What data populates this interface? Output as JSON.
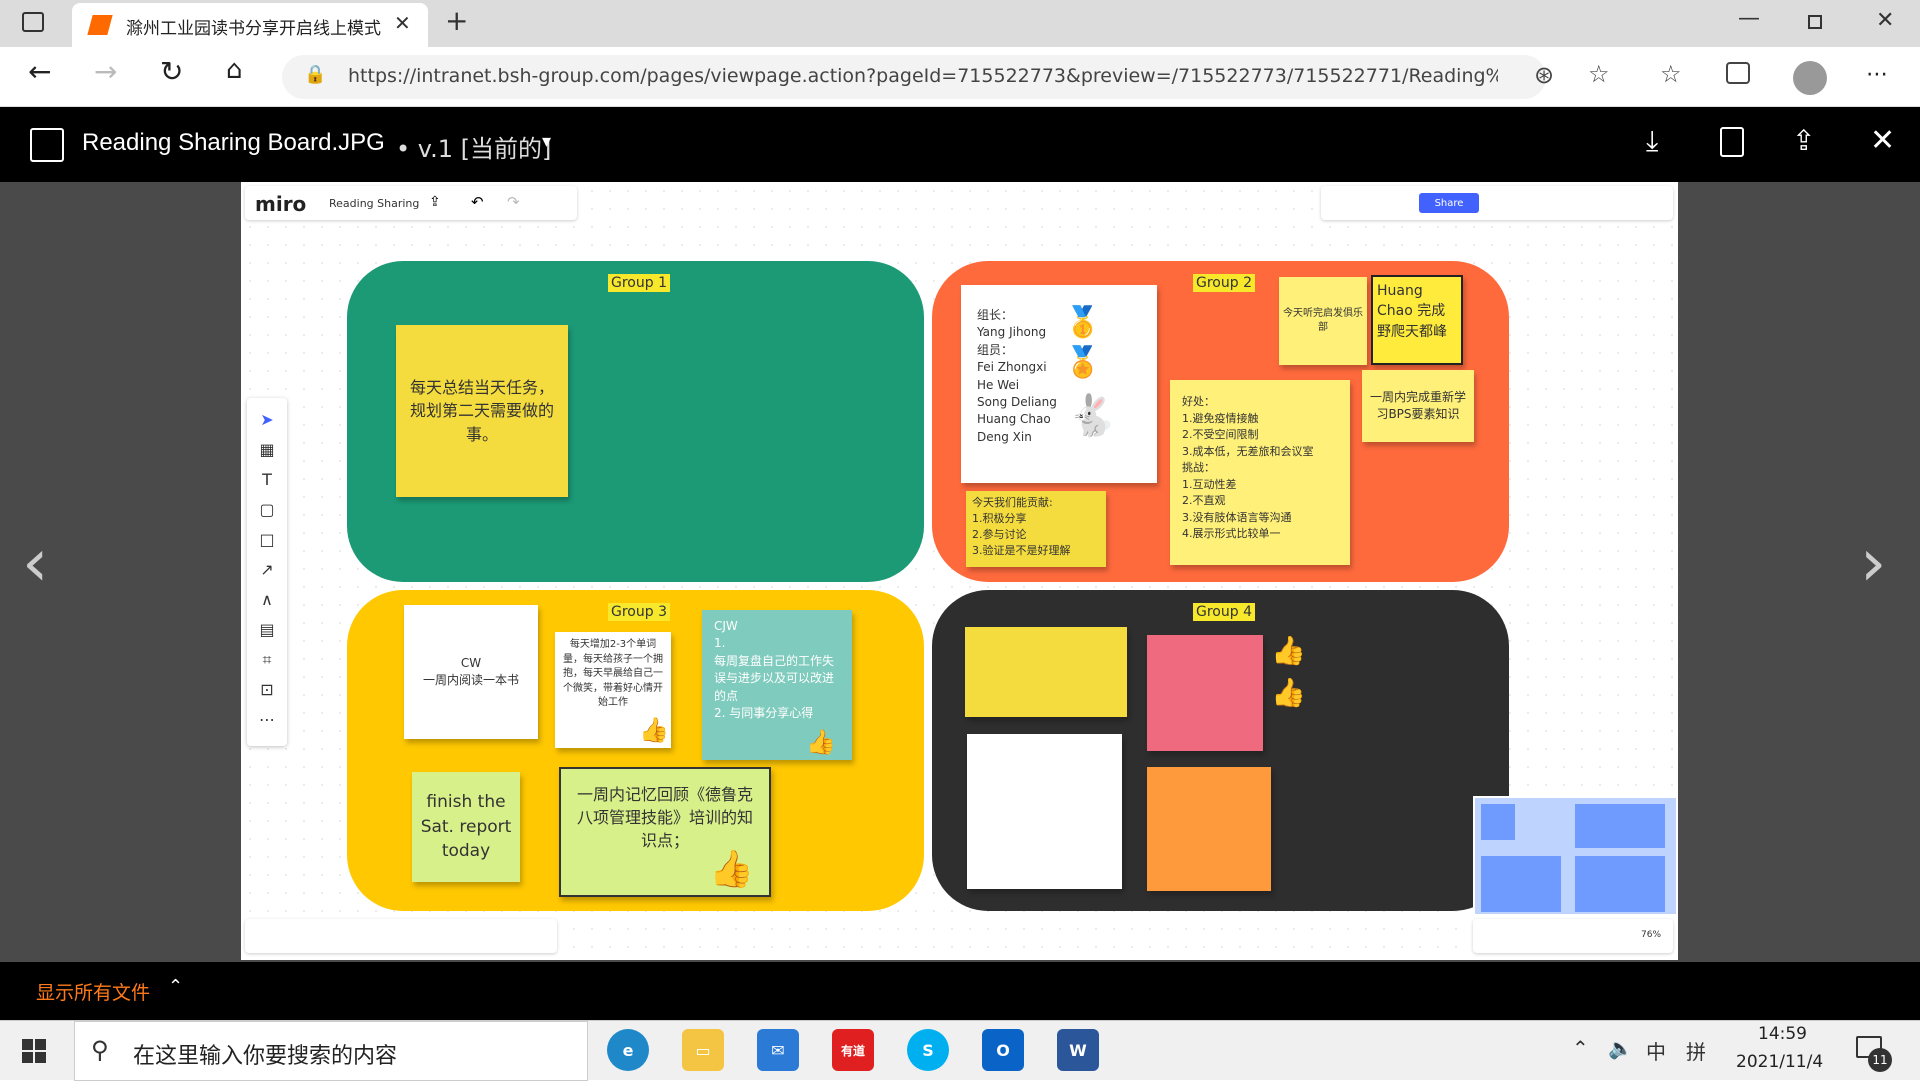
{
  "browser": {
    "tab_title": "滁州工业园读书分享开启线上模式",
    "url": "https://intranet.bsh-group.com/pages/viewpage.action?pageId=715522773&preview=/715522773/715522771/Reading%20..."
  },
  "viewer": {
    "file_name": "Reading Sharing Board.JPG",
    "version": "• v.1 [当前的]",
    "show_all_files": "显示所有文件"
  },
  "miro": {
    "logo": "miro",
    "board_name": "Reading Sharing",
    "share_label": "Share",
    "zoom": "76%"
  },
  "groups": {
    "g1": "Group 1",
    "g2": "Group 2",
    "g3": "Group 3",
    "g4": "Group 4"
  },
  "notes": {
    "g1_task": "每天总结当天任务，规划第二天需要做的事。",
    "g2_members": "组长：\nYang Jihong\n组员：\nFei Zhongxi\nHe Wei\nSong Deliang\nHuang Chao\nDeng Xin",
    "g2_club": "今天听完启发俱乐部",
    "g2_huang": "Huang Chao 完成野爬天都峰",
    "g2_bps": "一周内完成重新学习BPS要素知识",
    "g2_contrib": "今天我们能贡献:\n1.积极分享\n2.参与讨论\n3.验证是不是好理解",
    "g2_pros": "好处：\n1.避免疫情接触\n2.不受空间限制\n3.成本低，无差旅和会议室\n挑战：\n1.互动性差\n2.不直观\n3.没有肢体语言等沟通\n4.展示形式比较单一",
    "g3_cw": "CW\n一周内阅读一本书",
    "g3_words": "每天增加2-3个单词量，每天给孩子一个拥抱，每天早晨给自己一个微笑，带着好心情开始工作",
    "g3_cjw": "CJW\n1.\n每周复盘自己的工作失误与进步以及可以改进的点\n2. 与同事分享心得",
    "g3_finish": "finish the Sat. report today",
    "g3_drucker": "一周内记忆回顾《德鲁克八项管理技能》培训的知识点；"
  },
  "taskbar": {
    "search_placeholder": "在这里输入你要搜索的内容",
    "time": "14:59",
    "date": "2021/11/4",
    "ime": "中",
    "ime2": "拼",
    "notifications": "11"
  },
  "colors": {
    "green": "#1c9a76",
    "orange": "#ff6a3d",
    "yellow": "#ffc800",
    "dark": "#2e2e2e",
    "sticky_yellow": "#f5dc3e",
    "accent": "#ff7a1a"
  }
}
